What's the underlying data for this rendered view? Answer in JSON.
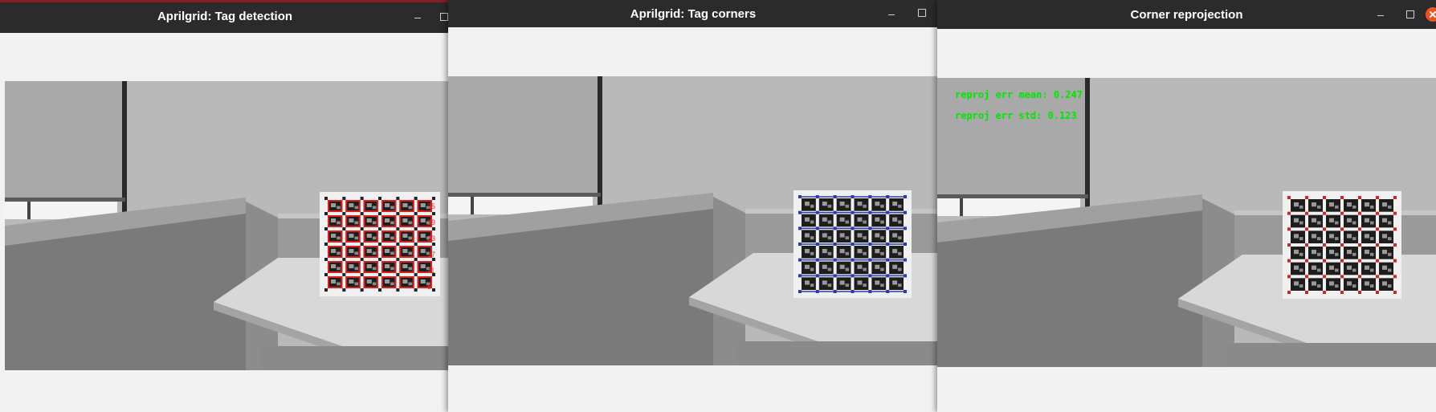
{
  "windows": [
    {
      "id": "tag-detection",
      "title": "Aprilgrid: Tag detection",
      "accent_color": "#8a1c24",
      "marker_color": "#d62020",
      "edge_color": "#2a3a9c",
      "tag_ids": [
        "35",
        "29",
        "23",
        "17",
        "11",
        "5"
      ]
    },
    {
      "id": "tag-corners",
      "title": "Aprilgrid: Tag corners",
      "marker_color": "#2a3aa8"
    },
    {
      "id": "corner-reprojection",
      "title": "Corner reprojection",
      "marker_color": "#c82828",
      "overlay": {
        "line1": "reproj err mean: 0.247",
        "line2": "reproj err std: 0.123",
        "color": "#00e600"
      }
    }
  ],
  "icons": {
    "minimize": "minimize-icon",
    "maximize": "maximize-icon",
    "close": "close-icon"
  }
}
